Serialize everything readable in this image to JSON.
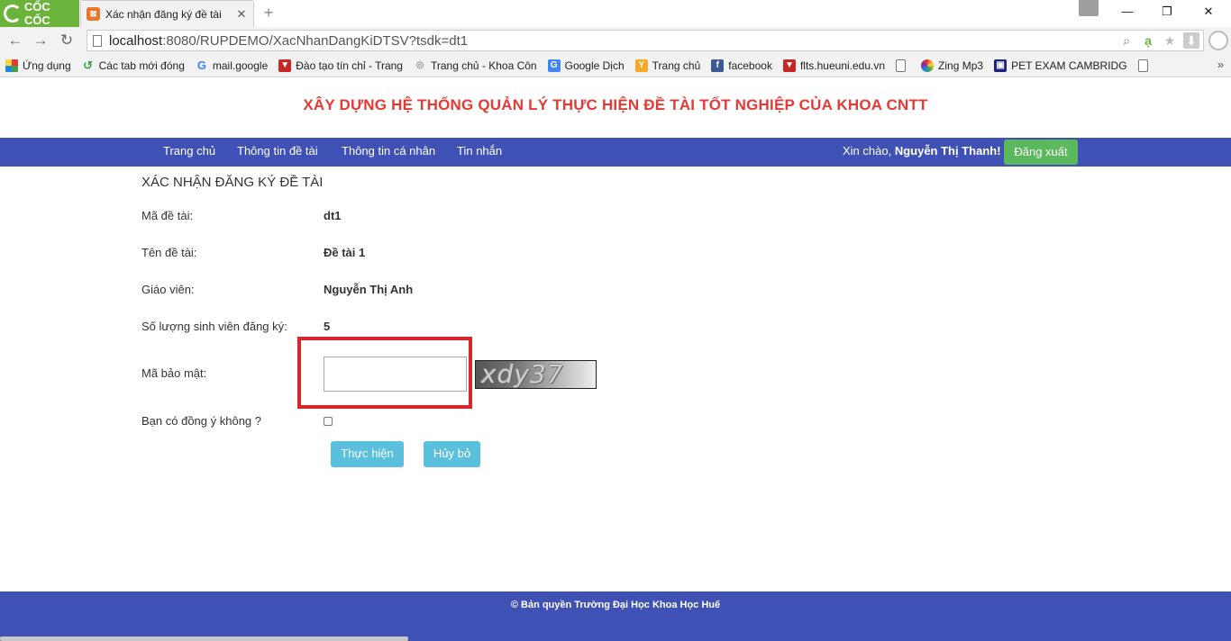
{
  "browser": {
    "brand": "CỐC CỐC",
    "tab_title": "Xác nhận đăng ký đề tài",
    "new_tab": "+",
    "url_host": "localhost",
    "url_path": ":8080/RUPDEMO/XacNhanDangKiDTSV?tsdk=dt1",
    "window_min": "—",
    "window_max": "❐",
    "window_close": "✕",
    "nav_back": "←",
    "nav_forward": "→",
    "nav_reload": "↻",
    "bookmarks": [
      {
        "label": "Ứng dụng",
        "icon": "apps-grid-icon"
      },
      {
        "label": "Các tab mới đóng",
        "icon": "history-icon"
      },
      {
        "label": "mail.google",
        "icon": "google-icon"
      },
      {
        "label": "Đào tạo tín chỉ - Trang",
        "icon": "shield-icon"
      },
      {
        "label": "Trang chủ - Khoa Côn",
        "icon": "site-icon"
      },
      {
        "label": "Google Dịch",
        "icon": "translate-icon"
      },
      {
        "label": "Trang chủ",
        "icon": "site-icon"
      },
      {
        "label": "facebook",
        "icon": "facebook-icon"
      },
      {
        "label": "flts.hueuni.edu.vn",
        "icon": "shield-icon"
      },
      {
        "label": "",
        "icon": "page-icon"
      },
      {
        "label": "Zing Mp3",
        "icon": "music-icon"
      },
      {
        "label": "PET EXAM CAMBRIDG",
        "icon": "site-icon"
      },
      {
        "label": "",
        "icon": "page-icon"
      }
    ],
    "bookmarks_more": "»"
  },
  "header": {
    "title": "XÂY DỰNG HỆ THỐNG QUẢN LÝ THỰC HIỆN ĐỀ TÀI TỐT NGHIỆP CỦA KHOA CNTT"
  },
  "nav": {
    "items": [
      "Trang chủ",
      "Thông tin đề tài",
      "Thông tin cá nhân",
      "Tin nhắn"
    ],
    "greeting_prefix": "Xin chào,",
    "user_name": "Nguyễn Thị Thanh!",
    "logout": "Đăng xuất"
  },
  "form": {
    "title": "XÁC NHẬN ĐĂNG KÝ ĐỀ TÀI",
    "rows": [
      {
        "label": "Mã đề tài:",
        "value": "dt1"
      },
      {
        "label": "Tên đề tài:",
        "value": "Đề tài 1"
      },
      {
        "label": "Giáo viên:",
        "value": "Nguyễn Thị Anh"
      },
      {
        "label": "Số lượng sinh viên đăng ký:",
        "value": "5"
      }
    ],
    "captcha_label": "Mã bảo mật:",
    "captcha_value": "",
    "captcha_text": "xdy37",
    "agree_label": "Bạn có đồng ý không ?",
    "agree_checked": false,
    "submit": "Thực hiện",
    "cancel": "Hủy bỏ"
  },
  "footer": {
    "text": "© Bản quyền Trường Đại Học Khoa Học Huế"
  },
  "colors": {
    "navbar": "#3f51b5",
    "title_red": "#e53935",
    "logout_green": "#5cb85c",
    "button_blue": "#5bc0de",
    "highlight_red": "#d7262c"
  }
}
